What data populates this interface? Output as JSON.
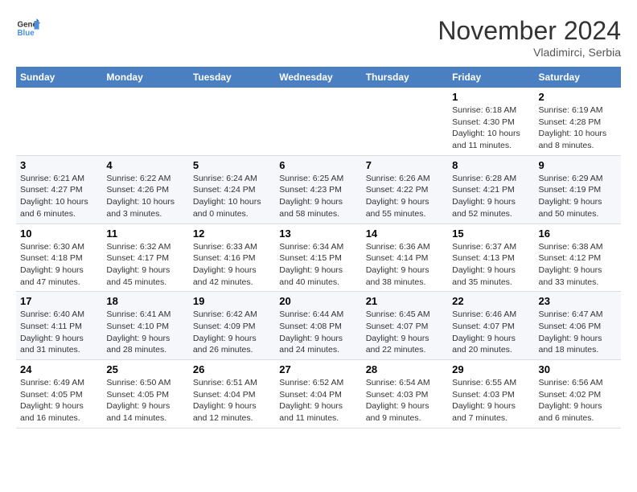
{
  "header": {
    "logo_line1": "General",
    "logo_line2": "Blue",
    "month": "November 2024",
    "location": "Vladimirci, Serbia"
  },
  "weekdays": [
    "Sunday",
    "Monday",
    "Tuesday",
    "Wednesday",
    "Thursday",
    "Friday",
    "Saturday"
  ],
  "weeks": [
    [
      {
        "day": "",
        "info": ""
      },
      {
        "day": "",
        "info": ""
      },
      {
        "day": "",
        "info": ""
      },
      {
        "day": "",
        "info": ""
      },
      {
        "day": "",
        "info": ""
      },
      {
        "day": "1",
        "info": "Sunrise: 6:18 AM\nSunset: 4:30 PM\nDaylight: 10 hours and 11 minutes."
      },
      {
        "day": "2",
        "info": "Sunrise: 6:19 AM\nSunset: 4:28 PM\nDaylight: 10 hours and 8 minutes."
      }
    ],
    [
      {
        "day": "3",
        "info": "Sunrise: 6:21 AM\nSunset: 4:27 PM\nDaylight: 10 hours and 6 minutes."
      },
      {
        "day": "4",
        "info": "Sunrise: 6:22 AM\nSunset: 4:26 PM\nDaylight: 10 hours and 3 minutes."
      },
      {
        "day": "5",
        "info": "Sunrise: 6:24 AM\nSunset: 4:24 PM\nDaylight: 10 hours and 0 minutes."
      },
      {
        "day": "6",
        "info": "Sunrise: 6:25 AM\nSunset: 4:23 PM\nDaylight: 9 hours and 58 minutes."
      },
      {
        "day": "7",
        "info": "Sunrise: 6:26 AM\nSunset: 4:22 PM\nDaylight: 9 hours and 55 minutes."
      },
      {
        "day": "8",
        "info": "Sunrise: 6:28 AM\nSunset: 4:21 PM\nDaylight: 9 hours and 52 minutes."
      },
      {
        "day": "9",
        "info": "Sunrise: 6:29 AM\nSunset: 4:19 PM\nDaylight: 9 hours and 50 minutes."
      }
    ],
    [
      {
        "day": "10",
        "info": "Sunrise: 6:30 AM\nSunset: 4:18 PM\nDaylight: 9 hours and 47 minutes."
      },
      {
        "day": "11",
        "info": "Sunrise: 6:32 AM\nSunset: 4:17 PM\nDaylight: 9 hours and 45 minutes."
      },
      {
        "day": "12",
        "info": "Sunrise: 6:33 AM\nSunset: 4:16 PM\nDaylight: 9 hours and 42 minutes."
      },
      {
        "day": "13",
        "info": "Sunrise: 6:34 AM\nSunset: 4:15 PM\nDaylight: 9 hours and 40 minutes."
      },
      {
        "day": "14",
        "info": "Sunrise: 6:36 AM\nSunset: 4:14 PM\nDaylight: 9 hours and 38 minutes."
      },
      {
        "day": "15",
        "info": "Sunrise: 6:37 AM\nSunset: 4:13 PM\nDaylight: 9 hours and 35 minutes."
      },
      {
        "day": "16",
        "info": "Sunrise: 6:38 AM\nSunset: 4:12 PM\nDaylight: 9 hours and 33 minutes."
      }
    ],
    [
      {
        "day": "17",
        "info": "Sunrise: 6:40 AM\nSunset: 4:11 PM\nDaylight: 9 hours and 31 minutes."
      },
      {
        "day": "18",
        "info": "Sunrise: 6:41 AM\nSunset: 4:10 PM\nDaylight: 9 hours and 28 minutes."
      },
      {
        "day": "19",
        "info": "Sunrise: 6:42 AM\nSunset: 4:09 PM\nDaylight: 9 hours and 26 minutes."
      },
      {
        "day": "20",
        "info": "Sunrise: 6:44 AM\nSunset: 4:08 PM\nDaylight: 9 hours and 24 minutes."
      },
      {
        "day": "21",
        "info": "Sunrise: 6:45 AM\nSunset: 4:07 PM\nDaylight: 9 hours and 22 minutes."
      },
      {
        "day": "22",
        "info": "Sunrise: 6:46 AM\nSunset: 4:07 PM\nDaylight: 9 hours and 20 minutes."
      },
      {
        "day": "23",
        "info": "Sunrise: 6:47 AM\nSunset: 4:06 PM\nDaylight: 9 hours and 18 minutes."
      }
    ],
    [
      {
        "day": "24",
        "info": "Sunrise: 6:49 AM\nSunset: 4:05 PM\nDaylight: 9 hours and 16 minutes."
      },
      {
        "day": "25",
        "info": "Sunrise: 6:50 AM\nSunset: 4:05 PM\nDaylight: 9 hours and 14 minutes."
      },
      {
        "day": "26",
        "info": "Sunrise: 6:51 AM\nSunset: 4:04 PM\nDaylight: 9 hours and 12 minutes."
      },
      {
        "day": "27",
        "info": "Sunrise: 6:52 AM\nSunset: 4:04 PM\nDaylight: 9 hours and 11 minutes."
      },
      {
        "day": "28",
        "info": "Sunrise: 6:54 AM\nSunset: 4:03 PM\nDaylight: 9 hours and 9 minutes."
      },
      {
        "day": "29",
        "info": "Sunrise: 6:55 AM\nSunset: 4:03 PM\nDaylight: 9 hours and 7 minutes."
      },
      {
        "day": "30",
        "info": "Sunrise: 6:56 AM\nSunset: 4:02 PM\nDaylight: 9 hours and 6 minutes."
      }
    ]
  ]
}
